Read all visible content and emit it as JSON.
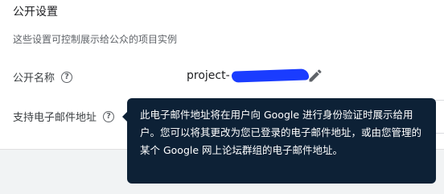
{
  "section": {
    "title": "公开设置",
    "description": "这些设置可控制展示给公众的项目实例"
  },
  "public_name": {
    "label": "公开名称",
    "help_icon": "help-circle-icon",
    "value_visible": "project-",
    "edit_icon": "pencil-icon"
  },
  "support_email": {
    "label": "支持电子邮件地址",
    "help_icon": "help-circle-icon"
  },
  "tooltip": {
    "text": "此电子邮件地址将在用户向 Google 进行身份验证时展示给用户。您可以将其更改为您已登录的电子邮件地址，或由您管理的某个 Google 网上论坛群组的电子邮件地址。"
  },
  "colors": {
    "tooltip_bg": "#0d2136",
    "redaction": "#1a3cff"
  }
}
